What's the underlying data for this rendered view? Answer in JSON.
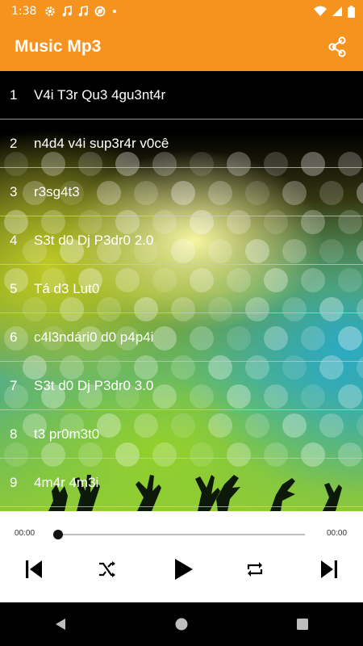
{
  "status_bar": {
    "time": "1:38",
    "notification_icons": [
      "gear-icon",
      "music-note-icon",
      "music-note-icon",
      "at-icon",
      "dot-icon"
    ],
    "system_icons": [
      "wifi-icon",
      "signal-icon",
      "battery-icon"
    ]
  },
  "app_bar": {
    "title": "Music Mp3",
    "share_icon": "share-icon",
    "color": "#F6921E"
  },
  "songs": [
    {
      "number": "1",
      "title": "V4i T3r Qu3 4gu3nt4r"
    },
    {
      "number": "2",
      "title": "n4d4 v4i sup3r4r v0cê"
    },
    {
      "number": "3",
      "title": "r3sg4t3"
    },
    {
      "number": "4",
      "title": "S3t d0 Dj P3dr0 2.0"
    },
    {
      "number": "5",
      "title": "Tá d3 Lut0"
    },
    {
      "number": "6",
      "title": "c4l3ndári0 d0 p4p4i"
    },
    {
      "number": "7",
      "title": "S3t d0 Dj P3dr0 3.0"
    },
    {
      "number": "8",
      "title": "t3 pr0m3t0"
    },
    {
      "number": "9",
      "title": "4m4r 4m3i"
    }
  ],
  "player": {
    "current_time": "00:00",
    "total_time": "00:00",
    "progress": 0,
    "controls": [
      "skip-previous-icon",
      "shuffle-icon",
      "play-icon",
      "repeat-icon",
      "skip-next-icon"
    ]
  },
  "nav_bar": {
    "buttons": [
      "back-icon",
      "home-icon",
      "recents-icon"
    ]
  }
}
